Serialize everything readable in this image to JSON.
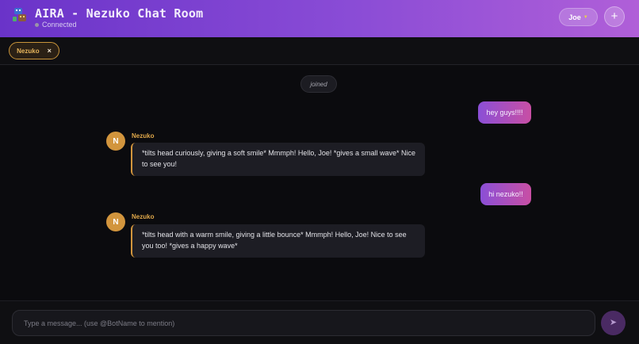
{
  "header": {
    "title": "AIRA - Nezuko Chat Room",
    "status": "Connected",
    "user_name": "Joe",
    "add_label": "+"
  },
  "bots": [
    {
      "name": "Nezuko",
      "remove_label": "×"
    }
  ],
  "messages": {
    "system": "joined",
    "user_1": "hey guys!!!!",
    "bot_1": {
      "avatar": "N",
      "name": "Nezuko",
      "text": "*tilts head curiously, giving a soft smile* Mmmph! Hello, Joe! *gives a small wave* Nice to see you!"
    },
    "user_2": "hi nezuko!!",
    "bot_2": {
      "avatar": "N",
      "name": "Nezuko",
      "text": "*tilts head with a warm smile, giving a little bounce* Mmmph! Hello, Joe! Nice to see you too! *gives a happy wave*"
    }
  },
  "composer": {
    "placeholder": "Type a message... (use @BotName to mention)",
    "send_icon": "send-arrow-icon"
  },
  "colors": {
    "header_start": "#6a33c9",
    "header_end": "#b05fd8",
    "bot_accent": "#d2953d",
    "user_bubble_start": "#8b4fd6",
    "user_bubble_end": "#c84fa4"
  }
}
